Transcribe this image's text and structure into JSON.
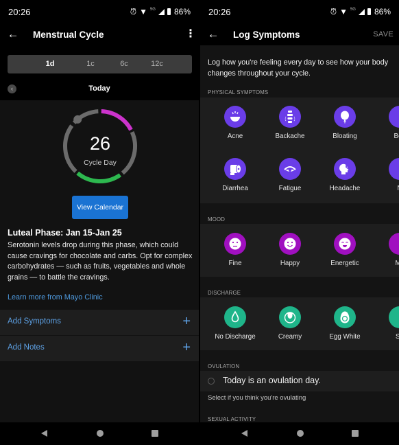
{
  "status_bar": {
    "time": "20:26",
    "network_label": "5G",
    "battery": "86%",
    "icons": [
      "alarm-icon",
      "wifi-icon",
      "signal-icon",
      "battery-icon"
    ]
  },
  "left": {
    "title": "Menstrual Cycle",
    "range_tabs": [
      {
        "label": "1d",
        "active": true
      },
      {
        "label": "1c",
        "active": false
      },
      {
        "label": "6c",
        "active": false
      },
      {
        "label": "12c",
        "active": false
      }
    ],
    "day_label": "Today",
    "cycle": {
      "day": "26",
      "caption": "Cycle Day",
      "colors": {
        "track": "#6b6b6b",
        "period": "#cc33cc",
        "fertile": "#2db84f",
        "marker": "#6b6b6b"
      }
    },
    "view_calendar_label": "View Calendar",
    "phase_title": "Luteal Phase: Jan 15-Jan 25",
    "phase_description": "Serotonin levels drop during this phase, which could cause cravings for chocolate and carbs. Opt for complex carbohydrates — such as fruits, vegetables and whole grains — to battle the cravings.",
    "learn_more_link": "Learn more from Mayo Clinic",
    "actions": [
      {
        "label": "Add Symptoms",
        "icon": "plus-icon"
      },
      {
        "label": "Add Notes",
        "icon": "plus-icon"
      }
    ]
  },
  "right": {
    "title": "Log Symptoms",
    "save_label": "SAVE",
    "intro": "Log how you're feeling every day to see how your body changes throughout your cycle.",
    "sections": {
      "physical": {
        "label": "PHYSICAL SYMPTOMS",
        "color": "#6a3de8",
        "items": [
          {
            "label": "Acne",
            "icon": "acne-icon"
          },
          {
            "label": "Backache",
            "icon": "backache-icon"
          },
          {
            "label": "Bloating",
            "icon": "bloating-icon"
          },
          {
            "label": "Boc",
            "icon": "partial-icon"
          },
          {
            "label": "Diarrhea",
            "icon": "diarrhea-icon"
          },
          {
            "label": "Fatigue",
            "icon": "fatigue-icon"
          },
          {
            "label": "Headache",
            "icon": "headache-icon"
          },
          {
            "label": "N",
            "icon": "partial-icon"
          }
        ]
      },
      "mood": {
        "label": "MOOD",
        "color": "#a010c0",
        "items": [
          {
            "label": "Fine",
            "icon": "neutral-face-icon"
          },
          {
            "label": "Happy",
            "icon": "smile-face-icon"
          },
          {
            "label": "Energetic",
            "icon": "energetic-face-icon"
          },
          {
            "label": "Mc",
            "icon": "partial-icon"
          }
        ]
      },
      "discharge": {
        "label": "DISCHARGE",
        "color": "#1fb58a",
        "items": [
          {
            "label": "No Discharge",
            "icon": "drop-icon"
          },
          {
            "label": "Creamy",
            "icon": "creamy-icon"
          },
          {
            "label": "Egg White",
            "icon": "egg-icon"
          },
          {
            "label": "Sp",
            "icon": "partial-icon"
          }
        ]
      },
      "ovulation": {
        "label": "OVULATION",
        "option": "Today is an ovulation day.",
        "checked": false,
        "hint": "Select if you think you're ovulating"
      },
      "sexual_activity": {
        "label": "SEXUAL ACTIVITY"
      }
    }
  }
}
